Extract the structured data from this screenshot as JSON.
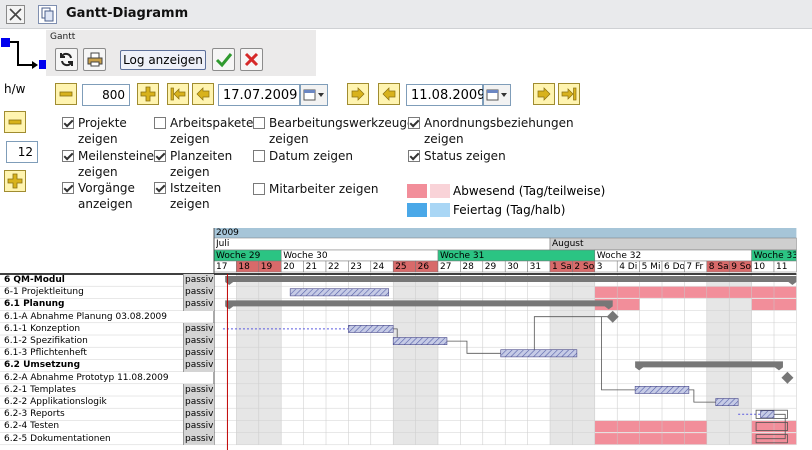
{
  "window": {
    "title": "Gantt-Diagramm"
  },
  "toolbar": {
    "caption": "Gantt",
    "log_label": "Log anzeigen"
  },
  "controls": {
    "hw_label": "h/w",
    "width_value": "800",
    "height_value": "12",
    "start_date": "17.07.2009",
    "end_date": "11.08.2009"
  },
  "options": [
    {
      "label": "Projekte zeigen",
      "checked": true
    },
    {
      "label": "Meilensteine zeigen",
      "checked": true
    },
    {
      "label": "Vorgänge anzeigen",
      "checked": true
    },
    {
      "label": "Arbeitspakete zeigen",
      "checked": false
    },
    {
      "label": "Planzeiten zeigen",
      "checked": true
    },
    {
      "label": "Istzeiten zeigen",
      "checked": true
    },
    {
      "label": "Bearbeitungswerkzeuge zeigen",
      "checked": false
    },
    {
      "label": "Datum zeigen",
      "checked": false
    },
    {
      "label": "Mitarbeiter zeigen",
      "checked": false
    },
    {
      "label": "Anordnungsbeziehungen zeigen",
      "checked": true
    },
    {
      "label": "Status zeigen",
      "checked": true
    }
  ],
  "legend": [
    {
      "label": "Abwesend (Tag/teilweise)",
      "color_full": "#f28e9a",
      "color_half": "#f9d3d8"
    },
    {
      "label": "Feiertag (Tag/halb)",
      "color_full": "#4aa8e8",
      "color_half": "#a9d6f5"
    }
  ],
  "gantt": {
    "year": "2009",
    "months": [
      {
        "label": "Juli",
        "start": 0
      },
      {
        "label": "August",
        "start": 15
      }
    ],
    "weeks": [
      {
        "label": "Woche 29",
        "start": 0,
        "len": 3,
        "current": true
      },
      {
        "label": "Woche 30",
        "start": 3,
        "len": 7,
        "current": false
      },
      {
        "label": "Woche 31",
        "start": 10,
        "len": 7,
        "current": true
      },
      {
        "label": "Woche 32",
        "start": 17,
        "len": 7,
        "current": false
      },
      {
        "label": "Woche 33",
        "start": 24,
        "len": 2,
        "current": true
      }
    ],
    "days": [
      {
        "label": "17",
        "weekend": false
      },
      {
        "label": "18",
        "weekend": true
      },
      {
        "label": "19",
        "weekend": true
      },
      {
        "label": "20",
        "weekend": false
      },
      {
        "label": "21",
        "weekend": false
      },
      {
        "label": "22",
        "weekend": false
      },
      {
        "label": "23",
        "weekend": false
      },
      {
        "label": "24",
        "weekend": false
      },
      {
        "label": "25",
        "weekend": true
      },
      {
        "label": "26",
        "weekend": true
      },
      {
        "label": "27",
        "weekend": false
      },
      {
        "label": "28",
        "weekend": false
      },
      {
        "label": "29",
        "weekend": false
      },
      {
        "label": "30",
        "weekend": false
      },
      {
        "label": "31",
        "weekend": false
      },
      {
        "label": "1 Sa",
        "weekend": true
      },
      {
        "label": "2 So",
        "weekend": true
      },
      {
        "label": "3",
        "weekend": false
      },
      {
        "label": "4 Di",
        "weekend": false
      },
      {
        "label": "5 Mi",
        "weekend": false
      },
      {
        "label": "6 Do",
        "weekend": false
      },
      {
        "label": "7 Fr",
        "weekend": false
      },
      {
        "label": "8 Sa",
        "weekend": true
      },
      {
        "label": "9 So",
        "weekend": true
      },
      {
        "label": "10",
        "weekend": false
      },
      {
        "label": "11",
        "weekend": false
      }
    ],
    "rows": [
      {
        "label": "6 QM-Modul",
        "status": "passiv",
        "bold": true
      },
      {
        "label": "6-1 Projektleitung",
        "status": "passiv",
        "bold": false
      },
      {
        "label": "6.1 Planung",
        "status": "passiv",
        "bold": true
      },
      {
        "label": "6.1-A Abnahme Planung 03.08.2009",
        "status": "",
        "bold": false
      },
      {
        "label": "6.1-1 Konzeption",
        "status": "passiv",
        "bold": false
      },
      {
        "label": "6.1-2 Spezifikation",
        "status": "passiv",
        "bold": false
      },
      {
        "label": "6.1-3 Pflichtenheft",
        "status": "passiv",
        "bold": false
      },
      {
        "label": "6.2 Umsetzung",
        "status": "passiv",
        "bold": true
      },
      {
        "label": "6.2-A Abnahme Prototyp 11.08.2009",
        "status": "",
        "bold": false
      },
      {
        "label": "6.2-1 Templates",
        "status": "passiv",
        "bold": false
      },
      {
        "label": "6.2-2 Applikationslogik",
        "status": "passiv",
        "bold": false
      },
      {
        "label": "6.2-3 Reports",
        "status": "passiv",
        "bold": false
      },
      {
        "label": "6.2-4 Testen",
        "status": "passiv",
        "bold": false
      },
      {
        "label": "6.2-5 Dokumentationen",
        "status": "passiv",
        "bold": false
      }
    ],
    "absent": [
      {
        "row": 1,
        "from": 17,
        "to": 24
      },
      {
        "row": 1,
        "from": 24,
        "to": 26
      },
      {
        "row": 2,
        "from": 17,
        "to": 19
      },
      {
        "row": 2,
        "from": 24,
        "to": 26
      },
      {
        "row": 12,
        "from": 17,
        "to": 22
      },
      {
        "row": 12,
        "from": 24,
        "to": 26
      },
      {
        "row": 13,
        "from": 17,
        "to": 22
      },
      {
        "row": 13,
        "from": 24,
        "to": 26
      }
    ],
    "summaries": [
      {
        "row": 0,
        "from": 0.5,
        "to": 26
      },
      {
        "row": 2,
        "from": 0.5,
        "to": 17.8
      },
      {
        "row": 7,
        "from": 18.8,
        "to": 25.4
      }
    ],
    "tasks": [
      {
        "row": 1,
        "from": 3.4,
        "to": 7.8
      },
      {
        "row": 4,
        "from": 6.0,
        "to": 8.0
      },
      {
        "row": 5,
        "from": 8.0,
        "to": 10.4
      },
      {
        "row": 6,
        "from": 12.8,
        "to": 16.2
      },
      {
        "row": 9,
        "from": 18.8,
        "to": 21.2
      },
      {
        "row": 10,
        "from": 22.4,
        "to": 23.4
      },
      {
        "row": 11,
        "from": 24.4,
        "to": 25.0
      }
    ],
    "milestones": [
      {
        "row": 3,
        "day": 17.8
      },
      {
        "row": 8,
        "day": 25.6
      }
    ]
  }
}
